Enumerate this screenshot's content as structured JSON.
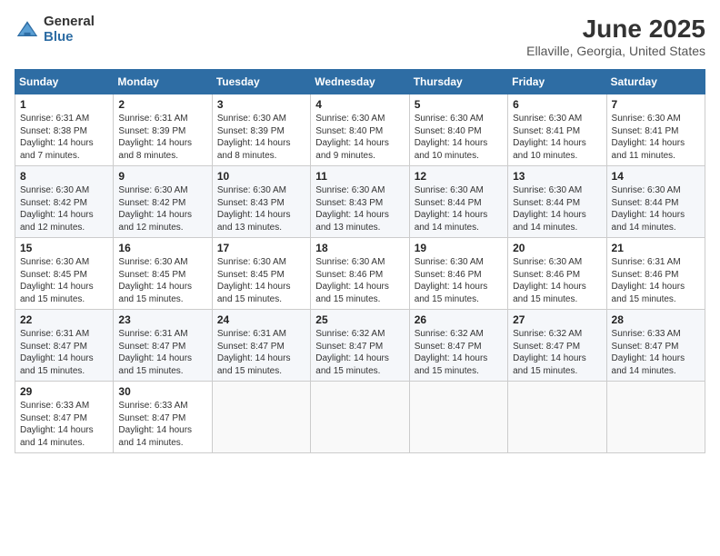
{
  "logo": {
    "general": "General",
    "blue": "Blue"
  },
  "title": "June 2025",
  "subtitle": "Ellaville, Georgia, United States",
  "days_header": [
    "Sunday",
    "Monday",
    "Tuesday",
    "Wednesday",
    "Thursday",
    "Friday",
    "Saturday"
  ],
  "weeks": [
    [
      {
        "day": "1",
        "sunrise": "Sunrise: 6:31 AM",
        "sunset": "Sunset: 8:38 PM",
        "daylight": "Daylight: 14 hours and 7 minutes."
      },
      {
        "day": "2",
        "sunrise": "Sunrise: 6:31 AM",
        "sunset": "Sunset: 8:39 PM",
        "daylight": "Daylight: 14 hours and 8 minutes."
      },
      {
        "day": "3",
        "sunrise": "Sunrise: 6:30 AM",
        "sunset": "Sunset: 8:39 PM",
        "daylight": "Daylight: 14 hours and 8 minutes."
      },
      {
        "day": "4",
        "sunrise": "Sunrise: 6:30 AM",
        "sunset": "Sunset: 8:40 PM",
        "daylight": "Daylight: 14 hours and 9 minutes."
      },
      {
        "day": "5",
        "sunrise": "Sunrise: 6:30 AM",
        "sunset": "Sunset: 8:40 PM",
        "daylight": "Daylight: 14 hours and 10 minutes."
      },
      {
        "day": "6",
        "sunrise": "Sunrise: 6:30 AM",
        "sunset": "Sunset: 8:41 PM",
        "daylight": "Daylight: 14 hours and 10 minutes."
      },
      {
        "day": "7",
        "sunrise": "Sunrise: 6:30 AM",
        "sunset": "Sunset: 8:41 PM",
        "daylight": "Daylight: 14 hours and 11 minutes."
      }
    ],
    [
      {
        "day": "8",
        "sunrise": "Sunrise: 6:30 AM",
        "sunset": "Sunset: 8:42 PM",
        "daylight": "Daylight: 14 hours and 12 minutes."
      },
      {
        "day": "9",
        "sunrise": "Sunrise: 6:30 AM",
        "sunset": "Sunset: 8:42 PM",
        "daylight": "Daylight: 14 hours and 12 minutes."
      },
      {
        "day": "10",
        "sunrise": "Sunrise: 6:30 AM",
        "sunset": "Sunset: 8:43 PM",
        "daylight": "Daylight: 14 hours and 13 minutes."
      },
      {
        "day": "11",
        "sunrise": "Sunrise: 6:30 AM",
        "sunset": "Sunset: 8:43 PM",
        "daylight": "Daylight: 14 hours and 13 minutes."
      },
      {
        "day": "12",
        "sunrise": "Sunrise: 6:30 AM",
        "sunset": "Sunset: 8:44 PM",
        "daylight": "Daylight: 14 hours and 14 minutes."
      },
      {
        "day": "13",
        "sunrise": "Sunrise: 6:30 AM",
        "sunset": "Sunset: 8:44 PM",
        "daylight": "Daylight: 14 hours and 14 minutes."
      },
      {
        "day": "14",
        "sunrise": "Sunrise: 6:30 AM",
        "sunset": "Sunset: 8:44 PM",
        "daylight": "Daylight: 14 hours and 14 minutes."
      }
    ],
    [
      {
        "day": "15",
        "sunrise": "Sunrise: 6:30 AM",
        "sunset": "Sunset: 8:45 PM",
        "daylight": "Daylight: 14 hours and 15 minutes."
      },
      {
        "day": "16",
        "sunrise": "Sunrise: 6:30 AM",
        "sunset": "Sunset: 8:45 PM",
        "daylight": "Daylight: 14 hours and 15 minutes."
      },
      {
        "day": "17",
        "sunrise": "Sunrise: 6:30 AM",
        "sunset": "Sunset: 8:45 PM",
        "daylight": "Daylight: 14 hours and 15 minutes."
      },
      {
        "day": "18",
        "sunrise": "Sunrise: 6:30 AM",
        "sunset": "Sunset: 8:46 PM",
        "daylight": "Daylight: 14 hours and 15 minutes."
      },
      {
        "day": "19",
        "sunrise": "Sunrise: 6:30 AM",
        "sunset": "Sunset: 8:46 PM",
        "daylight": "Daylight: 14 hours and 15 minutes."
      },
      {
        "day": "20",
        "sunrise": "Sunrise: 6:30 AM",
        "sunset": "Sunset: 8:46 PM",
        "daylight": "Daylight: 14 hours and 15 minutes."
      },
      {
        "day": "21",
        "sunrise": "Sunrise: 6:31 AM",
        "sunset": "Sunset: 8:46 PM",
        "daylight": "Daylight: 14 hours and 15 minutes."
      }
    ],
    [
      {
        "day": "22",
        "sunrise": "Sunrise: 6:31 AM",
        "sunset": "Sunset: 8:47 PM",
        "daylight": "Daylight: 14 hours and 15 minutes."
      },
      {
        "day": "23",
        "sunrise": "Sunrise: 6:31 AM",
        "sunset": "Sunset: 8:47 PM",
        "daylight": "Daylight: 14 hours and 15 minutes."
      },
      {
        "day": "24",
        "sunrise": "Sunrise: 6:31 AM",
        "sunset": "Sunset: 8:47 PM",
        "daylight": "Daylight: 14 hours and 15 minutes."
      },
      {
        "day": "25",
        "sunrise": "Sunrise: 6:32 AM",
        "sunset": "Sunset: 8:47 PM",
        "daylight": "Daylight: 14 hours and 15 minutes."
      },
      {
        "day": "26",
        "sunrise": "Sunrise: 6:32 AM",
        "sunset": "Sunset: 8:47 PM",
        "daylight": "Daylight: 14 hours and 15 minutes."
      },
      {
        "day": "27",
        "sunrise": "Sunrise: 6:32 AM",
        "sunset": "Sunset: 8:47 PM",
        "daylight": "Daylight: 14 hours and 15 minutes."
      },
      {
        "day": "28",
        "sunrise": "Sunrise: 6:33 AM",
        "sunset": "Sunset: 8:47 PM",
        "daylight": "Daylight: 14 hours and 14 minutes."
      }
    ],
    [
      {
        "day": "29",
        "sunrise": "Sunrise: 6:33 AM",
        "sunset": "Sunset: 8:47 PM",
        "daylight": "Daylight: 14 hours and 14 minutes."
      },
      {
        "day": "30",
        "sunrise": "Sunrise: 6:33 AM",
        "sunset": "Sunset: 8:47 PM",
        "daylight": "Daylight: 14 hours and 14 minutes."
      },
      null,
      null,
      null,
      null,
      null
    ]
  ]
}
